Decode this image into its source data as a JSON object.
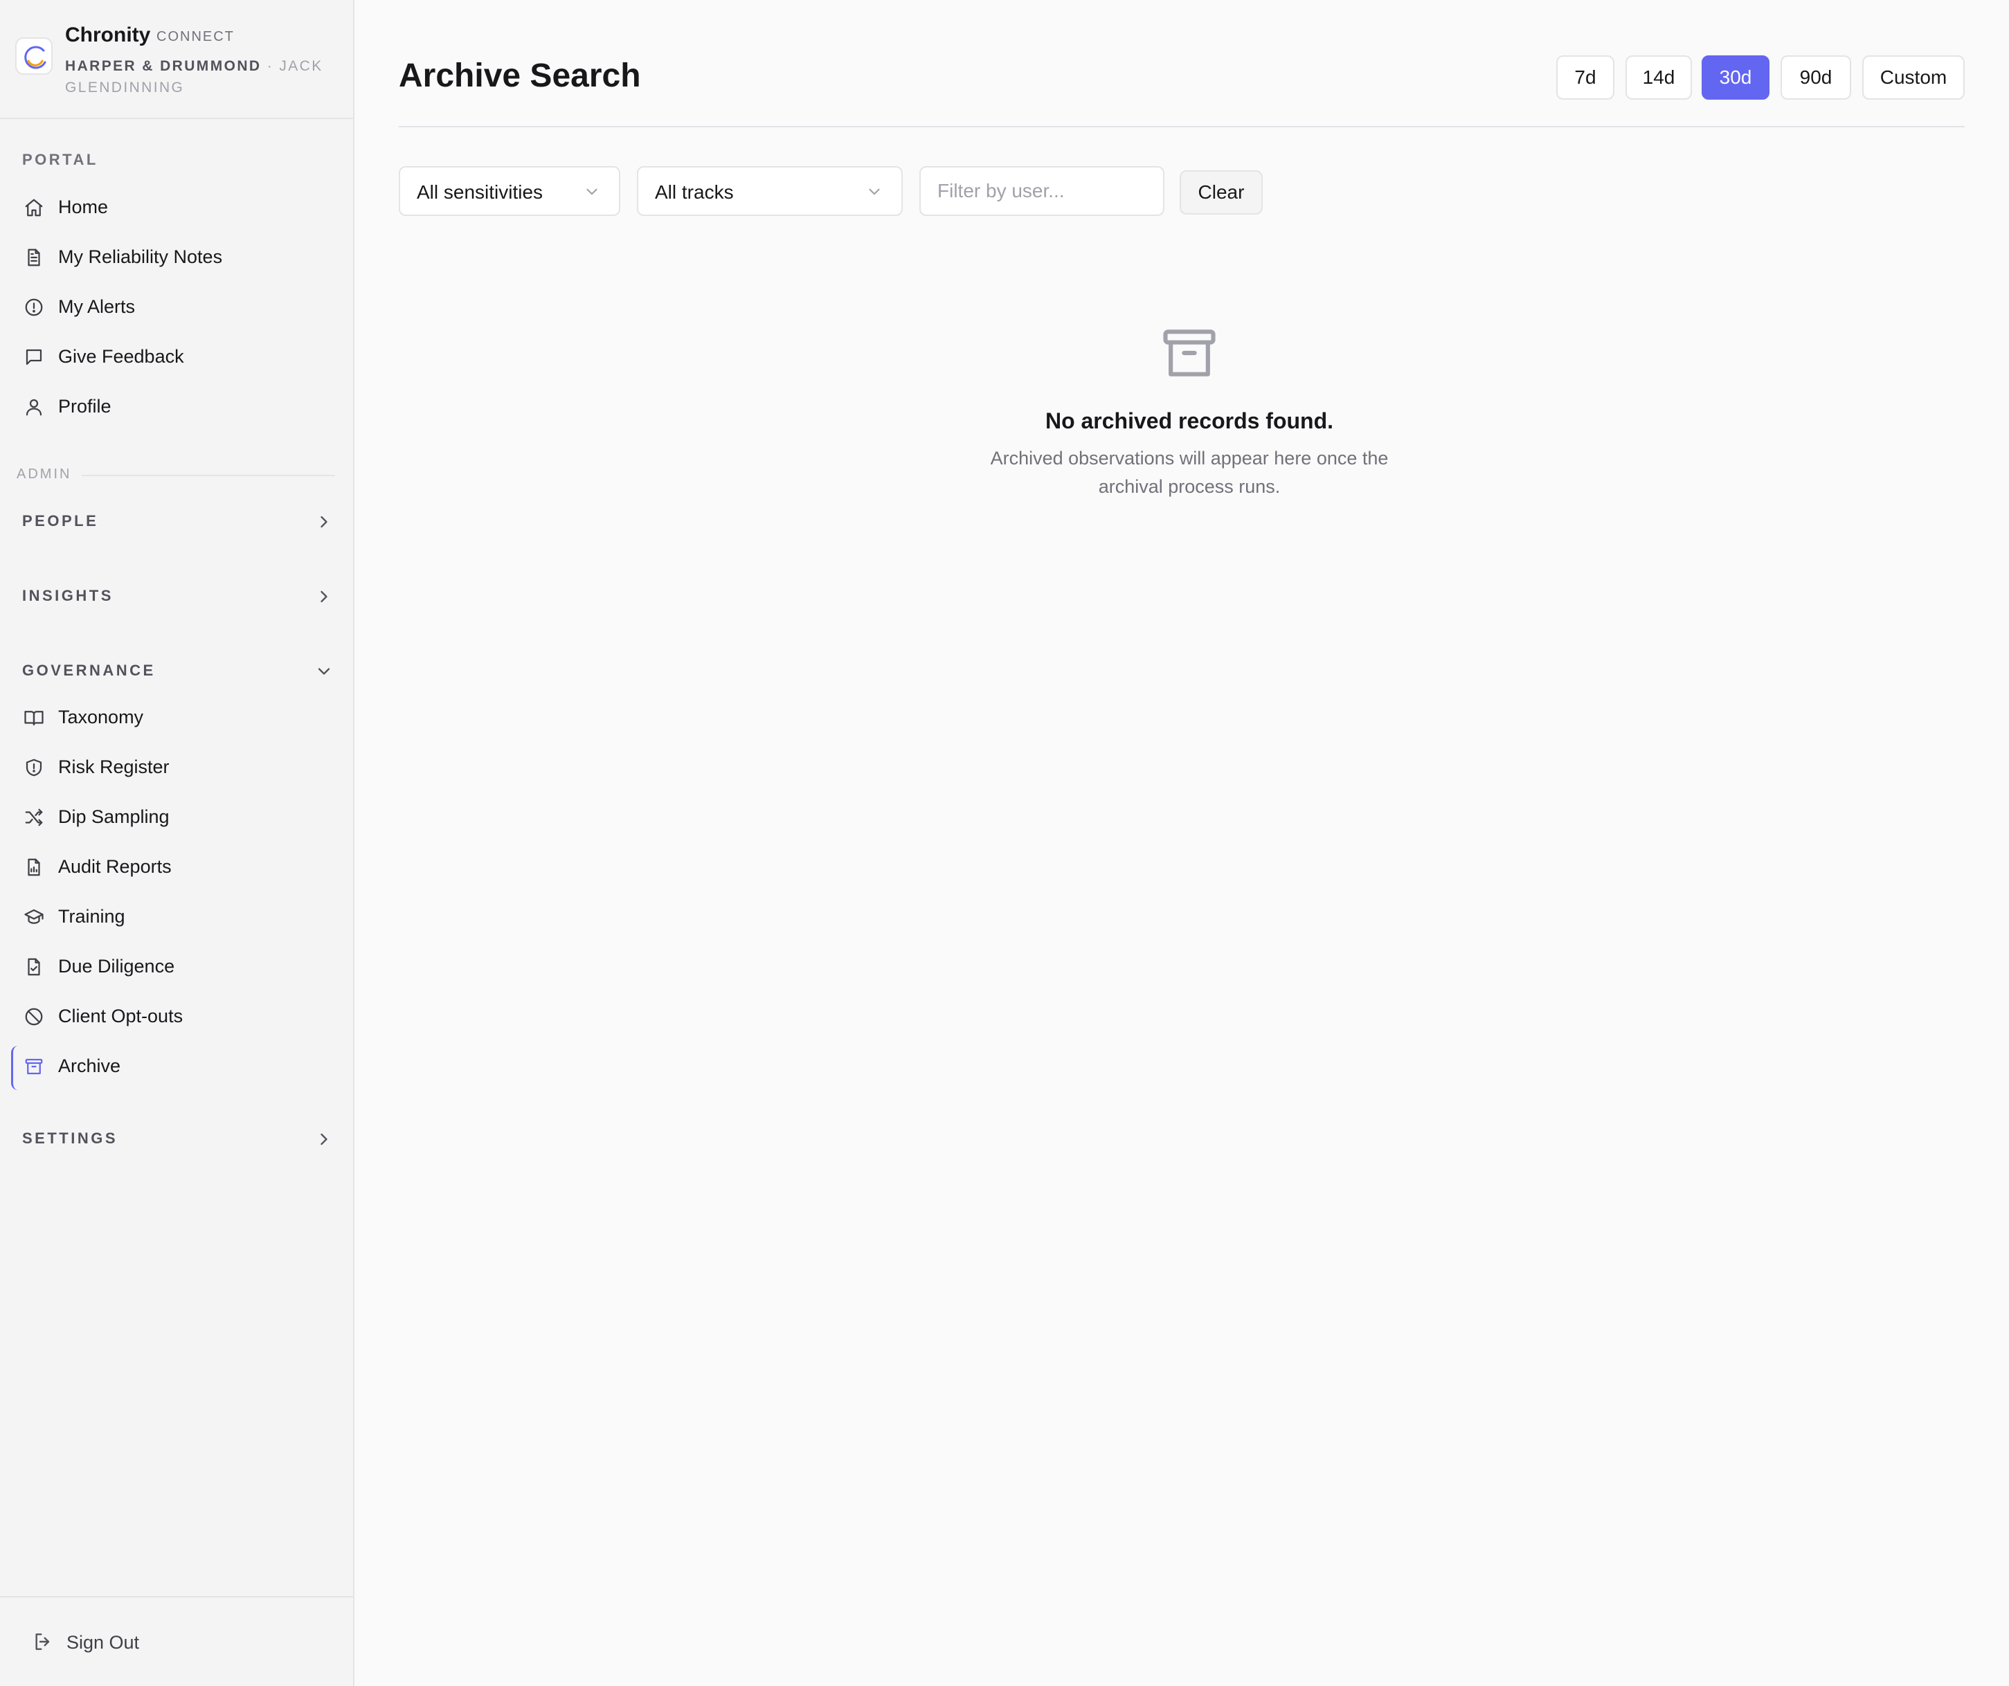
{
  "brand": {
    "name": "Chronity",
    "product": "CONNECT",
    "org": "HARPER & DRUMMOND",
    "separator": "·",
    "user": "JACK GLENDINNING",
    "accent": "#6366f1"
  },
  "sidebar": {
    "portal_label": "PORTAL",
    "portal_items": [
      {
        "label": "Home",
        "icon": "home-icon"
      },
      {
        "label": "My Reliability Notes",
        "icon": "document-icon"
      },
      {
        "label": "My Alerts",
        "icon": "alert-circle-icon"
      },
      {
        "label": "Give Feedback",
        "icon": "message-square-icon"
      },
      {
        "label": "Profile",
        "icon": "user-icon"
      }
    ],
    "admin_label": "ADMIN",
    "groups": {
      "people": {
        "label": "PEOPLE",
        "expanded": false
      },
      "insights": {
        "label": "INSIGHTS",
        "expanded": false
      },
      "governance": {
        "label": "GOVERNANCE",
        "expanded": true
      },
      "settings": {
        "label": "SETTINGS",
        "expanded": false
      }
    },
    "governance_items": [
      {
        "label": "Taxonomy",
        "icon": "book-open-icon"
      },
      {
        "label": "Risk Register",
        "icon": "shield-alert-icon"
      },
      {
        "label": "Dip Sampling",
        "icon": "shuffle-icon"
      },
      {
        "label": "Audit Reports",
        "icon": "file-chart-icon"
      },
      {
        "label": "Training",
        "icon": "graduation-cap-icon"
      },
      {
        "label": "Due Diligence",
        "icon": "file-check-icon"
      },
      {
        "label": "Client Opt-outs",
        "icon": "ban-icon"
      },
      {
        "label": "Archive",
        "icon": "archive-icon",
        "active": true
      }
    ],
    "signout_label": "Sign Out"
  },
  "main": {
    "title": "Archive Search",
    "ranges": [
      "7d",
      "14d",
      "30d",
      "90d",
      "Custom"
    ],
    "selected_range": "30d",
    "filters": {
      "sensitivity": "All sensitivities",
      "tracks": "All tracks",
      "user_placeholder": "Filter by user...",
      "user_value": "",
      "clear_label": "Clear"
    },
    "empty_state": {
      "icon": "archive-icon",
      "title": "No archived records found.",
      "description": "Archived observations will appear here once the archival process runs."
    }
  }
}
